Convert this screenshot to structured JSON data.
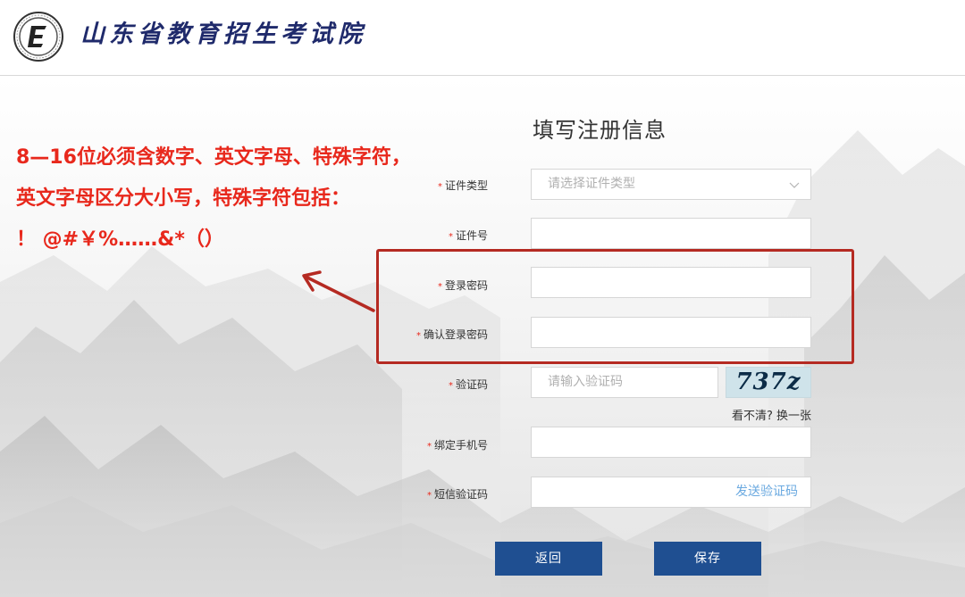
{
  "header": {
    "site_title": "山东省教育招生考试院"
  },
  "annotation": {
    "line1": "8—16位必须含数字、英文字母、特殊字符，",
    "line2": "英文字母区分大小写，特殊字符包括：",
    "line3": "！ @#￥%……&*（）"
  },
  "form": {
    "title": "填写注册信息",
    "required_mark": "*",
    "id_type": {
      "label": "证件类型",
      "placeholder": "请选择证件类型"
    },
    "id_number": {
      "label": "证件号",
      "value": ""
    },
    "password": {
      "label": "登录密码",
      "value": ""
    },
    "confirm_password": {
      "label": "确认登录密码",
      "value": ""
    },
    "captcha": {
      "label": "验证码",
      "placeholder": "请输入验证码",
      "image_text": "737z",
      "refresh_link": "看不清? 换一张"
    },
    "phone": {
      "label": "绑定手机号",
      "value": ""
    },
    "sms_code": {
      "label": "短信验证码",
      "send_button": "发送验证码"
    },
    "buttons": {
      "back": "返回",
      "save": "保存"
    }
  },
  "colors": {
    "brand": "#1f2a6b",
    "button": "#1f4f91",
    "annotation": "#e8281c",
    "highlight": "#b52a22",
    "link": "#6aa9e0"
  },
  "icons": [
    "exam-institute-logo-icon",
    "chevron-down-icon",
    "annotation-arrow-icon"
  ]
}
